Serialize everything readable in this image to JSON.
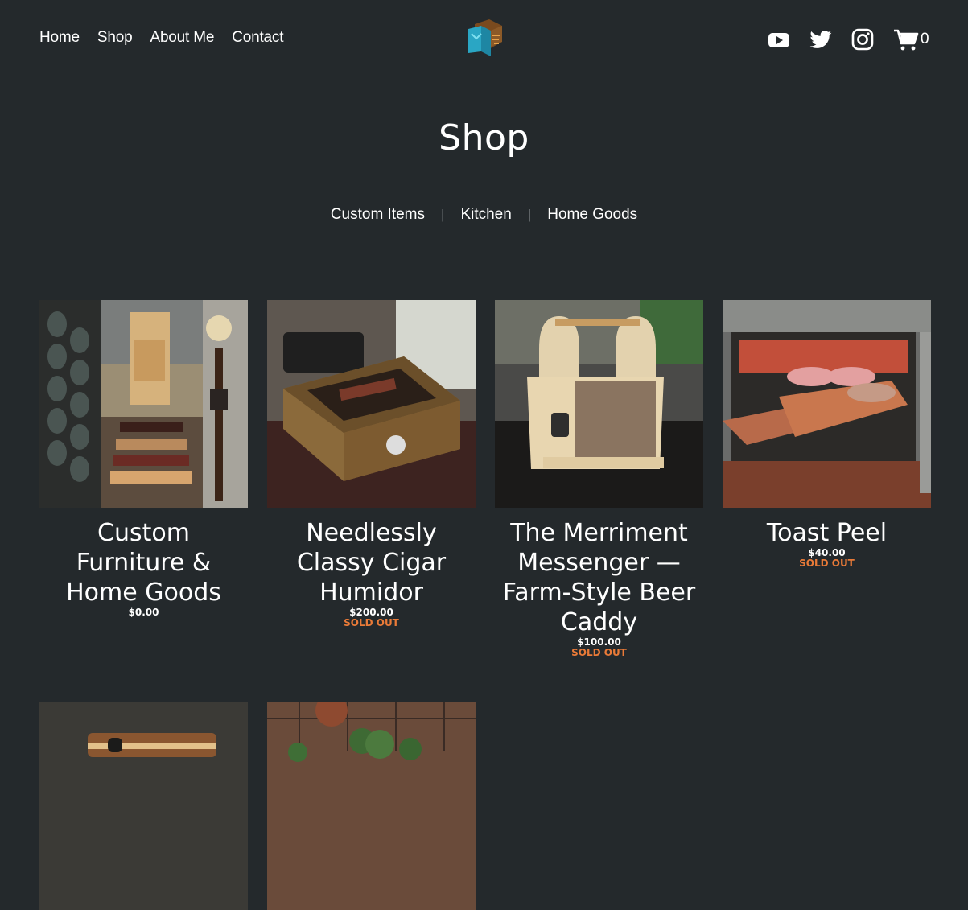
{
  "nav": {
    "items": [
      {
        "label": "Home",
        "active": false
      },
      {
        "label": "Shop",
        "active": true
      },
      {
        "label": "About Me",
        "active": false
      },
      {
        "label": "Contact",
        "active": false
      }
    ]
  },
  "social": {
    "icons": [
      "youtube-icon",
      "twitter-icon",
      "instagram-icon"
    ]
  },
  "cart": {
    "count": "0"
  },
  "page_title": "Shop",
  "categories": [
    "Custom Items",
    "Kitchen",
    "Home Goods"
  ],
  "products": [
    {
      "name": "Custom Furniture & Home Goods",
      "price": "$0.00",
      "status": ""
    },
    {
      "name": "Needlessly Classy Cigar Humidor",
      "price": "$200.00",
      "status": "SOLD OUT"
    },
    {
      "name": "The Merriment Messenger — Farm-Style Beer Caddy",
      "price": "$100.00",
      "status": "SOLD OUT"
    },
    {
      "name": "Toast Peel",
      "price": "$40.00",
      "status": "SOLD OUT"
    }
  ],
  "colors": {
    "background": "#24292c",
    "sold_out": "#e97a38",
    "divider": "#5b6164"
  }
}
